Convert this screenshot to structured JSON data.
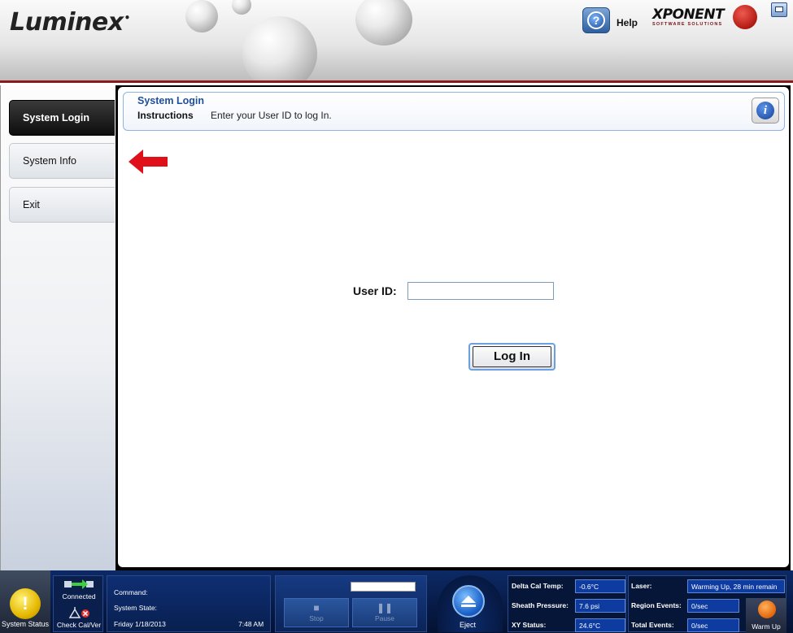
{
  "header": {
    "logo": "Luminex",
    "help_label": "Help",
    "brand_name": "XPONENT",
    "brand_sub": "SOFTWARE SOLUTIONS"
  },
  "nav": {
    "items": [
      {
        "label": "System Login",
        "active": true
      },
      {
        "label": "System Info",
        "active": false
      },
      {
        "label": "Exit",
        "active": false
      }
    ]
  },
  "panel": {
    "title": "System Login",
    "instructions_label": "Instructions",
    "instructions_text": "Enter your User ID to log In."
  },
  "login": {
    "user_id_label": "User ID:",
    "user_id_value": "",
    "button_label": "Log In"
  },
  "status": {
    "system_status_label": "System Status",
    "connected_label": "Connected",
    "check_label": "Check Cal/Ver",
    "command_label": "Command:",
    "system_state_label": "System State:",
    "date": "Friday 1/18/2013",
    "time": "7:48 AM",
    "stop_label": "Stop",
    "pause_label": "Pause",
    "eject_label": "Eject",
    "delta_cal_temp_label": "Delta Cal Temp:",
    "delta_cal_temp_value": "-0.6°C",
    "sheath_pressure_label": "Sheath Pressure:",
    "sheath_pressure_value": "7.6 psi",
    "xy_status_label": "XY Status:",
    "xy_status_value": "24.6°C",
    "laser_label": "Laser:",
    "laser_value": "Warming Up, 28 min remain",
    "region_events_label": "Region Events:",
    "region_events_value": "0/sec",
    "total_events_label": "Total Events:",
    "total_events_value": "0/sec",
    "warm_up_label": "Warm Up"
  },
  "colors": {
    "accent_blue": "#1f4f9c",
    "header_rule": "#8b1a1a",
    "arrow_red": "#e0101a",
    "statusbar_bg": "#071a45",
    "warning_yellow": "#e5b800"
  },
  "icons": [
    "help-icon",
    "info-icon",
    "minimize-icon",
    "warning-icon",
    "connected-icon",
    "check-calver-icon",
    "stop-icon",
    "pause-icon",
    "eject-icon",
    "warm-up-icon",
    "pointer-arrow-icon"
  ]
}
